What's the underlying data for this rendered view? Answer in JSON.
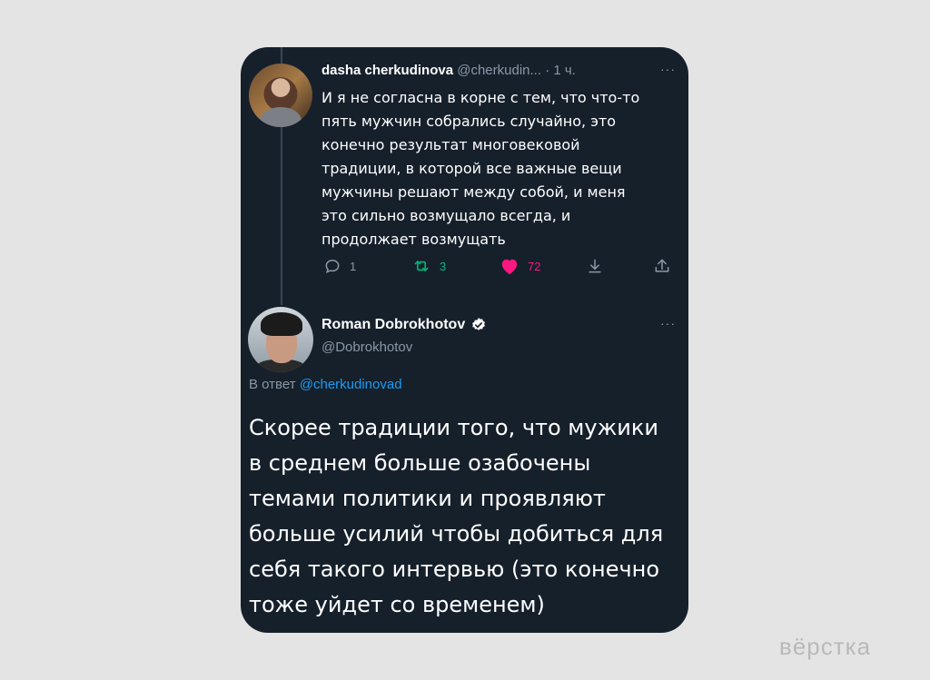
{
  "tweet1": {
    "display_name": "dasha cherkudinova",
    "handle": "@cherkudin...",
    "time": "· 1 ч.",
    "more": "···",
    "lines": [
      "И я не согласна в корне с тем, что что-то",
      "пять мужчин собрались случайно, это",
      "конечно результат многовековой",
      "традиции, в которой все важные вещи",
      "мужчины решают между собой, и меня",
      "это сильно возмущало всегда, и",
      "продолжает возмущать"
    ],
    "actions": {
      "reply_count": "1",
      "retweet_count": "3",
      "like_count": "72"
    }
  },
  "tweet2": {
    "display_name": "Roman Dobrokhotov",
    "handle": "@Dobrokhotov",
    "more": "···",
    "reply_prefix": "В ответ",
    "reply_mention": "@cherkudinovad",
    "lines": [
      "Скорее традиции того, что мужики",
      "в среднем больше озабочены",
      "темами политики и проявляют",
      "больше усилий чтобы добиться для",
      "себя такого интервью (это конечно",
      "тоже уйдет со временем)"
    ]
  },
  "watermark": "вёрстка",
  "colors": {
    "background": "#e4e4e4",
    "card": "#15202b",
    "text": "#ffffff",
    "muted": "#8b98a5",
    "link": "#1d9bf0",
    "retweet": "#00ba7c",
    "like": "#f91880"
  },
  "icons": [
    "reply-icon",
    "retweet-icon",
    "like-icon",
    "bookmark-icon",
    "share-icon",
    "verified-icon",
    "more-icon"
  ]
}
